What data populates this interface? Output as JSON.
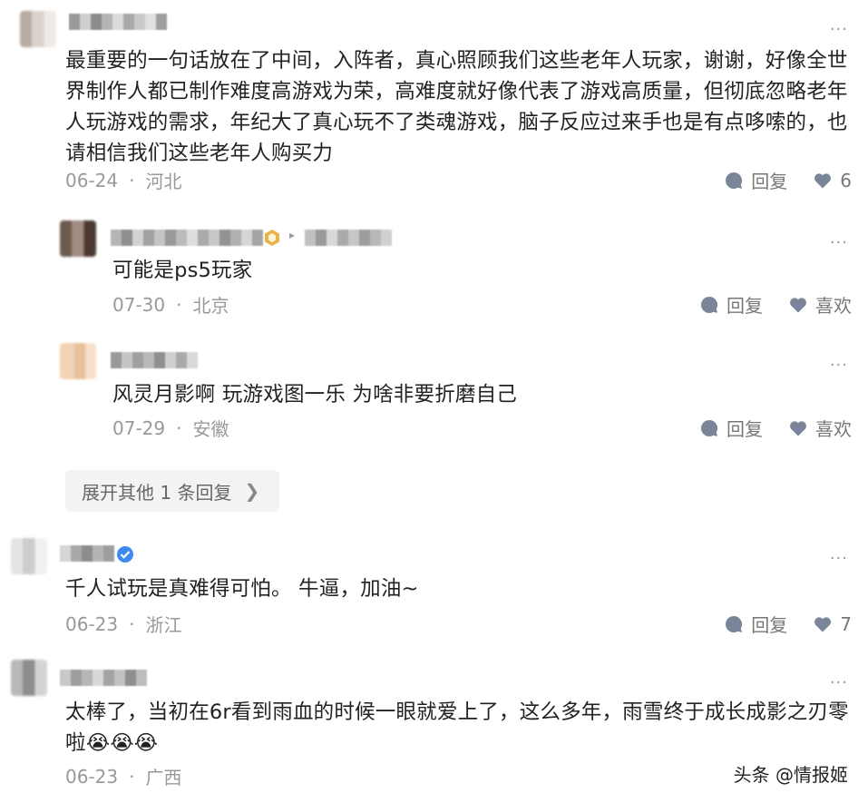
{
  "comments": [
    {
      "text": "最重要的一句话放在了中间，入阵者，真心照顾我们这些老年人玩家，谢谢，好像全世界制作人都已制作难度高游戏为荣，高难度就好像代表了游戏高质量，但彻底忽略老年人玩游戏的需求，年纪大了真心玩不了类魂游戏，脑子反应过来手也是有点哆嗦的，也请相信我们这些老年人购买力",
      "line1": "最重要的一句话放在了中间，入阵者，真心照顾我们这些老年人玩家，谢谢，好像全世",
      "line2": "界制作人都已制作难度高游戏为荣，高难度就好像代表了游戏高质量，但彻底忽略老年",
      "line3": "人玩游戏的需求，年纪大了真心玩不了类魂游戏，脑子反应过来手也是有点哆嗦的，也",
      "line4": "请相信我们这些老年人购买力",
      "date": "06-24",
      "location": "河北",
      "reply_label": "回复",
      "like_label": "6"
    },
    {
      "text": "可能是ps5玩家",
      "date": "07-30",
      "location": "北京",
      "reply_label": "回复",
      "like_label": "喜欢"
    },
    {
      "text": "风灵月影啊 玩游戏图一乐 为啥非要折磨自己",
      "date": "07-29",
      "location": "安徽",
      "reply_label": "回复",
      "like_label": "喜欢"
    },
    {
      "text": "千人试玩是真难得可怕。 牛逼，加油~",
      "date": "06-23",
      "location": "浙江",
      "reply_label": "回复",
      "like_label": "7"
    },
    {
      "line1": "太棒了，当初在6r看到雨血的时候一眼就爱上了，这么多年，雨雪终于成长成影之刃零",
      "line2": "啦😭😭😭",
      "date": "06-23",
      "location": "广西"
    }
  ],
  "expand_label": "展开其他 1 条回复",
  "more_label": "···",
  "separator": "·",
  "watermark": "头条 @情报姬",
  "colors": {
    "text": "#222222",
    "meta": "#999999",
    "verified": "#3d8bf2"
  },
  "icons": [
    "comment-icon",
    "heart-icon",
    "more-icon",
    "chevron-right-icon",
    "verified-icon",
    "level-badge-icon",
    "caret-right-icon"
  ]
}
